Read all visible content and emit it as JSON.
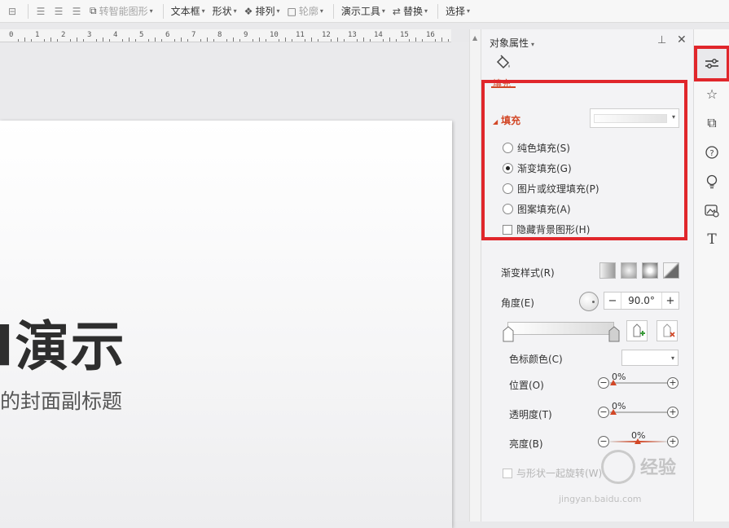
{
  "toolbar": {
    "items": [
      {
        "label": "转智能图形",
        "disabled": true
      },
      {
        "label": "文本框"
      },
      {
        "label": "形状"
      },
      {
        "label": "排列"
      },
      {
        "label": "轮廓",
        "disabled": true
      },
      {
        "label": "演示工具"
      },
      {
        "label": "替换"
      },
      {
        "label": "选择"
      }
    ]
  },
  "ruler": {
    "labels": [
      "0",
      "1",
      "2",
      "3",
      "4",
      "5",
      "6",
      "7",
      "8",
      "9",
      "10",
      "11",
      "12",
      "13",
      "14",
      "15",
      "16"
    ]
  },
  "slide": {
    "title": "l演示",
    "subtitle": "的封面副标题"
  },
  "panel": {
    "title": "对象属性",
    "fill_tab_label": "填充",
    "fill_section": {
      "label": "填充",
      "options": [
        {
          "label": "纯色填充(S)",
          "checked": false
        },
        {
          "label": "渐变填充(G)",
          "checked": true
        },
        {
          "label": "图片或纹理填充(P)",
          "checked": false
        },
        {
          "label": "图案填充(A)",
          "checked": false
        }
      ],
      "hide_bg_label": "隐藏背景图形(H)"
    },
    "gradient_style_label": "渐变样式(R)",
    "angle_label": "角度(E)",
    "angle_value": "90.0°",
    "stop_color_label": "色标颜色(C)",
    "position_label": "位置(O)",
    "position_value": "0%",
    "transparency_label": "透明度(T)",
    "transparency_value": "0%",
    "brightness_label": "亮度(B)",
    "brightness_value": "0%",
    "rotate_with_shape_label": "与形状一起旋转(W)"
  },
  "sidebar": {
    "icons": [
      "properties-icon",
      "animation-star-icon",
      "slide-switch-icon",
      "help-icon",
      "lightbulb-icon",
      "image-edit-icon",
      "text-icon"
    ]
  },
  "watermark": {
    "brand": "经验",
    "url": "jingyan.baidu.com"
  },
  "colors": {
    "accent": "#d24726",
    "highlight": "#e0262b"
  }
}
